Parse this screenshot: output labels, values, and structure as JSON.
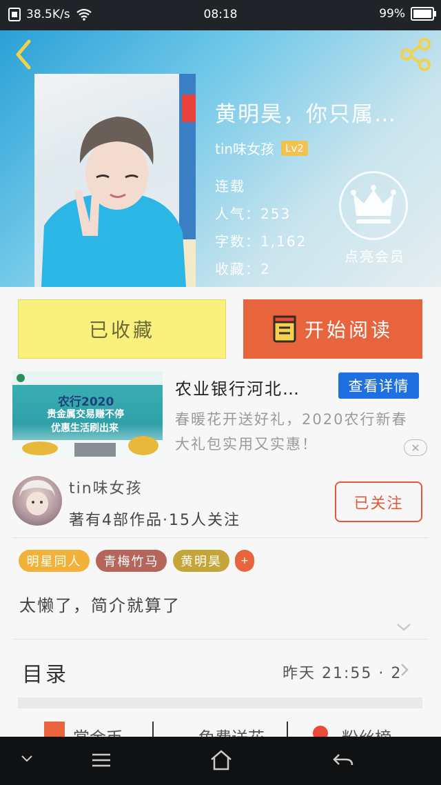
{
  "status_bar": {
    "network_speed": "38.5K/s",
    "time": "08:18",
    "battery": "99%"
  },
  "book": {
    "title": "黄明昊，你只属…",
    "author": "tin味女孩",
    "level": "Lv2",
    "status": "连载",
    "popularity": "人气：253",
    "word_count": "字数：1,162",
    "favorites": "收藏：2"
  },
  "vip": {
    "label": "点亮会员"
  },
  "actions": {
    "favorited": "已收藏",
    "start_reading": "开始阅读"
  },
  "ad": {
    "image_title": "农行2020",
    "image_line1": "贵金属交易赚不停",
    "image_line2": "优惠生活刷出来",
    "title": "农业银行河北…",
    "button": "查看详情",
    "description": "春暖花开送好礼，2020农行新春大礼包实用又实惠！",
    "close": "✕"
  },
  "author_card": {
    "name": "tin味女孩",
    "stats": "著有4部作品·15人关注",
    "follow_button": "已关注"
  },
  "tags": [
    "明星同人",
    "青梅竹马",
    "黄明昊",
    "+"
  ],
  "intro": "太懒了，简介就算了",
  "toc": {
    "label": "目录",
    "update": "昨天 21:55 · 2"
  },
  "bottom_items": [
    "赏金币",
    "免费送花",
    "粉丝榜"
  ],
  "colors": {
    "accent_orange": "#e8643c",
    "fav_yellow": "#f9f17b",
    "ad_blue": "#1e6fe0",
    "follow_red": "#e2573a"
  }
}
